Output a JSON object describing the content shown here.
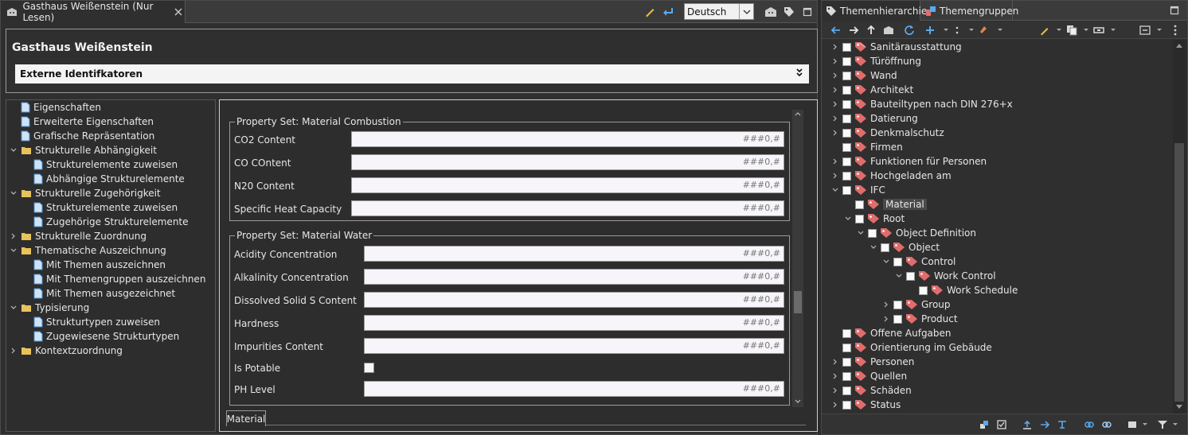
{
  "editor": {
    "tab_title": "Gasthaus Weißenstein (Nur Lesen)",
    "language": "Deutsch",
    "title": "Gasthaus Weißenstein",
    "section": "Externe Identifkatoren"
  },
  "nav": {
    "items": [
      {
        "label": "Eigenschaften"
      },
      {
        "label": "Erweiterte Eigenschaften"
      },
      {
        "label": "Grafische Repräsentation"
      },
      {
        "label": "Strukturelle Abhängigkeit"
      },
      {
        "label": "Strukturelemente zuweisen"
      },
      {
        "label": "Abhängige Strukturelemente"
      },
      {
        "label": "Strukturelle Zugehörigkeit"
      },
      {
        "label": "Strukturelemente zuweisen"
      },
      {
        "label": "Zugehörige Strukturelemente"
      },
      {
        "label": "Strukturelle Zuordnung"
      },
      {
        "label": "Thematische Auszeichnung"
      },
      {
        "label": "Mit Themen auszeichnen"
      },
      {
        "label": "Mit Themengruppen auszeichnen"
      },
      {
        "label": "Mit Themen ausgezeichnet"
      },
      {
        "label": "Typisierung"
      },
      {
        "label": "Strukturtypen zuweisen"
      },
      {
        "label": "Zugewiesene Strukturtypen"
      },
      {
        "label": "Kontextzuordnung"
      }
    ]
  },
  "props": {
    "group1": {
      "title": "Property Set: Material Combustion",
      "rows": [
        {
          "label": "CO2 Content",
          "value": "###0,#"
        },
        {
          "label": "CO COntent",
          "value": "###0,#"
        },
        {
          "label": "N20 Content",
          "value": "###0,#"
        },
        {
          "label": "Specific Heat Capacity",
          "value": "###0,#"
        }
      ]
    },
    "group2": {
      "title": "Property Set: Material Water",
      "rows": [
        {
          "label": "Acidity Concentration",
          "value": "###0,#"
        },
        {
          "label": "Alkalinity Concentration",
          "value": "###0,#"
        },
        {
          "label": "Dissolved Solid S Content",
          "value": "###0,#"
        },
        {
          "label": "Hardness",
          "value": "###0,#"
        },
        {
          "label": "Impurities Content",
          "value": "###0,#"
        },
        {
          "label": "Is Potable",
          "value": ""
        },
        {
          "label": "PH Level",
          "value": "###0,#"
        }
      ]
    },
    "bottom_tab": "Material"
  },
  "rview": {
    "tab1": "Themenhierarchie",
    "tab2": "Themengruppen",
    "tree": [
      {
        "label": "Sanitärausstattung"
      },
      {
        "label": "Türöffnung"
      },
      {
        "label": "Wand"
      },
      {
        "label": "Architekt"
      },
      {
        "label": "Bauteiltypen nach DIN 276+x"
      },
      {
        "label": "Datierung"
      },
      {
        "label": "Denkmalschutz"
      },
      {
        "label": "Firmen"
      },
      {
        "label": "Funktionen für Personen"
      },
      {
        "label": "Hochgeladen am"
      },
      {
        "label": "IFC"
      },
      {
        "label": "Material"
      },
      {
        "label": "Root"
      },
      {
        "label": "Object Definition"
      },
      {
        "label": "Object"
      },
      {
        "label": "Control"
      },
      {
        "label": "Work Control"
      },
      {
        "label": "Work Schedule"
      },
      {
        "label": "Group"
      },
      {
        "label": "Product"
      },
      {
        "label": "Offene Aufgaben"
      },
      {
        "label": "Orientierung im Gebäude"
      },
      {
        "label": "Personen"
      },
      {
        "label": "Quellen"
      },
      {
        "label": "Schäden"
      },
      {
        "label": "Status"
      }
    ]
  },
  "icons": {
    "page": "document-icon",
    "folder": "folder-icon",
    "tag": "tag-icon",
    "accent": "#3f8fd6",
    "tag_color": "#e06c6c",
    "folder_color": "#e8c35a"
  }
}
